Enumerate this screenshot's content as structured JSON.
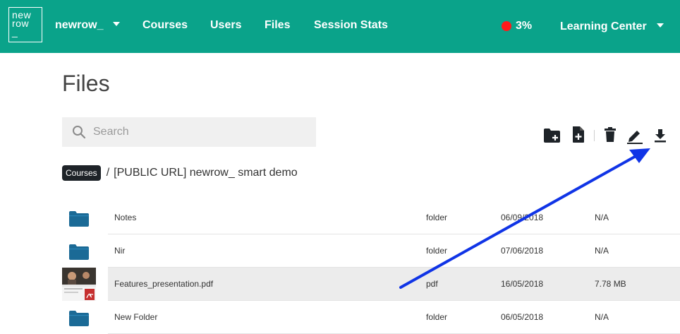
{
  "topbar": {
    "logo_line1": "new",
    "logo_line2": "row",
    "logo_line3": "_",
    "org_label": "newrow_",
    "nav": [
      "Courses",
      "Users",
      "Files",
      "Session Stats"
    ],
    "recording_percent": "3%",
    "account_label": "Learning Center",
    "bg_color": "#0aa38a"
  },
  "page": {
    "title": "Files"
  },
  "search": {
    "placeholder": "Search",
    "value": ""
  },
  "toolbar": {
    "icons": [
      "new-folder-icon",
      "new-file-icon",
      "delete-icon",
      "rename-icon",
      "download-icon"
    ]
  },
  "breadcrumb": {
    "root": "Courses",
    "separator": "/",
    "current": "[PUBLIC URL] newrow_ smart demo"
  },
  "files": [
    {
      "name": "Notes",
      "type": "folder",
      "date": "06/09/2018",
      "size": "N/A",
      "icon": "folder-icon",
      "selected": false
    },
    {
      "name": "Nir",
      "type": "folder",
      "date": "07/06/2018",
      "size": "N/A",
      "icon": "folder-icon",
      "selected": false
    },
    {
      "name": "Features_presentation.pdf",
      "type": "pdf",
      "date": "16/05/2018",
      "size": "7.78 MB",
      "icon": "pdf-thumbnail",
      "selected": true
    },
    {
      "name": "New Folder",
      "type": "folder",
      "date": "06/05/2018",
      "size": "N/A",
      "icon": "folder-icon",
      "selected": false
    }
  ],
  "colors": {
    "accent": "#0aa38a",
    "folder": "#1b6a96",
    "annotation_arrow": "#1034e6",
    "recording_dot": "#ff1a1a"
  }
}
